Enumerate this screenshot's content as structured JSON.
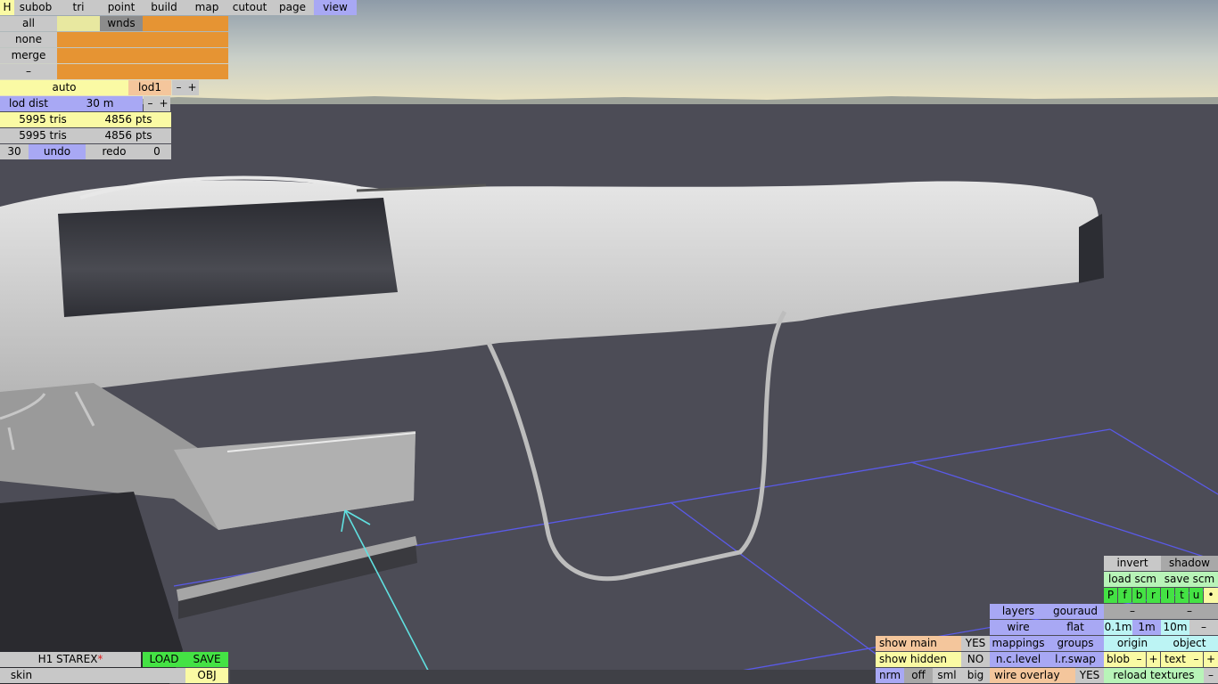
{
  "colors": {
    "lightgray": "#c8c8c8",
    "gray": "#a8a8a8",
    "darkgray": "#8c8c8c",
    "blue": "#a8a8f4",
    "yellow": "#fafaa4",
    "paleyellow": "#e8e8a0",
    "orange": "#e69433",
    "salmon": "#f4c69c",
    "green": "#44e244",
    "lightgreen": "#b8f4b8",
    "cyan": "#bcf4f4",
    "white": "#ffffff"
  },
  "topbar": {
    "h": "H",
    "subob": "subob",
    "tri": "tri",
    "point": "point",
    "build": "build",
    "map": "map",
    "cutout": "cutout",
    "page": "page",
    "view": "view"
  },
  "sel": {
    "all": "all",
    "none": "none",
    "merge": "merge",
    "dash": "–",
    "wnds": "wnds"
  },
  "lod": {
    "auto": "auto",
    "lod1": "lod1",
    "minus": "–",
    "plus": "+",
    "dist_label": "lod dist",
    "dist_value": "30 m"
  },
  "stats": {
    "tris1": "5995 tris",
    "pts1": "4856 pts",
    "tris2": "5995 tris",
    "pts2": "4856 pts"
  },
  "history": {
    "count": "30",
    "undo": "undo",
    "redo": "redo",
    "zero": "0"
  },
  "file": {
    "name": "H1 STAREX",
    "modified_mark": "*",
    "load": "LOAD",
    "save": "SAVE",
    "skin": "skin",
    "skin_value": "",
    "obj": "OBJ"
  },
  "right": {
    "invert": "invert",
    "shadow": "shadow",
    "load_scm": "load scm",
    "save_scm": "save scm",
    "views": [
      "P",
      "f",
      "b",
      "r",
      "l",
      "t",
      "u"
    ],
    "dot": "•",
    "layers": "layers",
    "gouraud": "gouraud",
    "dash": "–",
    "wire": "wire",
    "flat": "flat",
    "s01": "0.1m",
    "s1": "1m",
    "s10": "10m",
    "show_main": "show main",
    "show_main_val": "YES",
    "mappings": "mappings",
    "groups": "groups",
    "origin": "origin",
    "object": "object",
    "show_hidden": "show hidden",
    "show_hidden_val": "NO",
    "nclevel": "n.c.level",
    "lrswap": "l.r.swap",
    "blob": "blob",
    "text": "text",
    "minus": "–",
    "plus": "+",
    "nrm": "nrm",
    "off": "off",
    "sml": "sml",
    "big": "big",
    "wire_overlay": "wire overlay",
    "wire_overlay_val": "YES",
    "reload_textures": "reload textures"
  }
}
